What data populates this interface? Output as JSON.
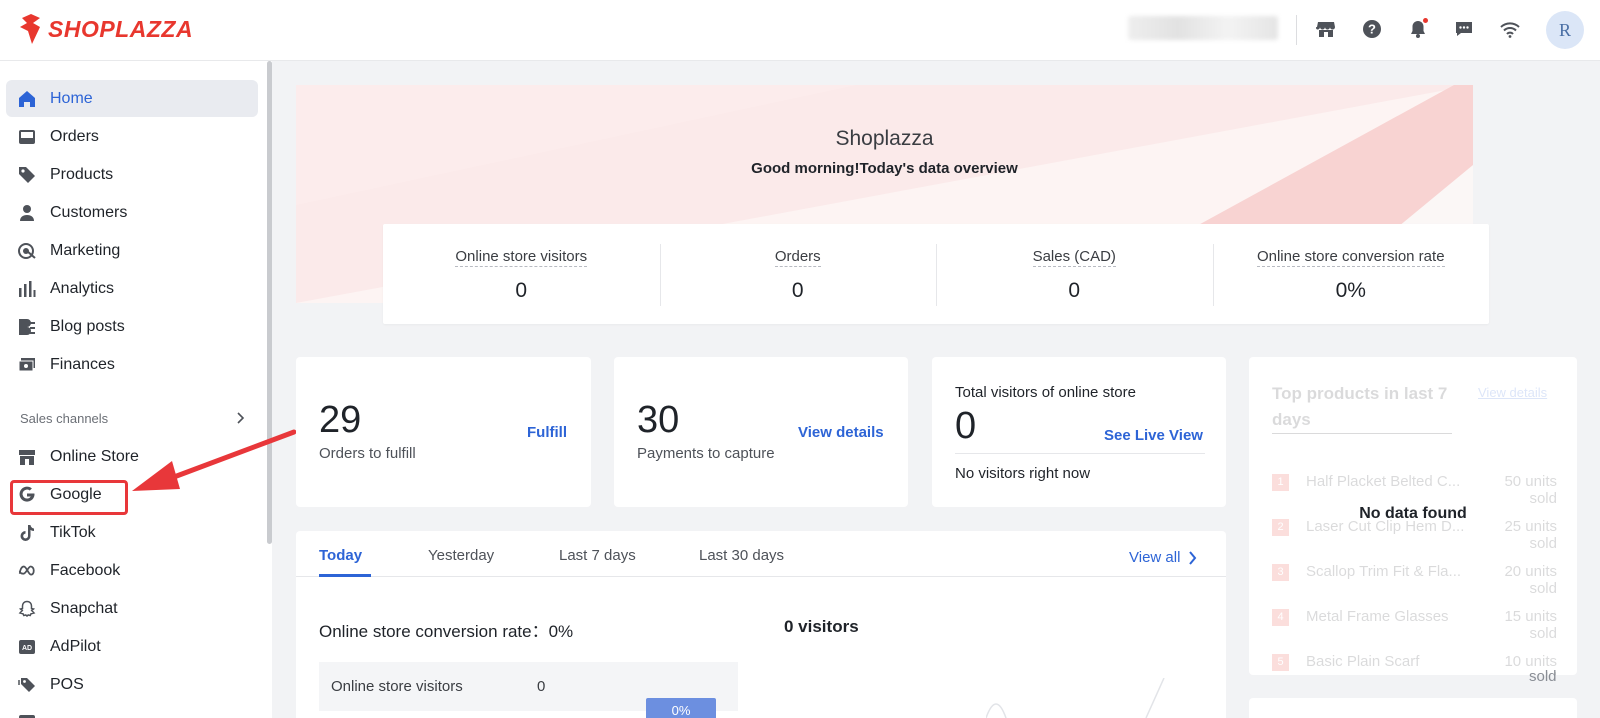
{
  "brand": {
    "name": "SHOPLAZZA",
    "accent": "#e8372e",
    "link": "#2d64d6"
  },
  "topbar": {
    "icons": [
      "store-icon",
      "help-icon",
      "bell-icon",
      "message-icon",
      "wifi-icon"
    ],
    "avatar": "R"
  },
  "sidebar": {
    "items": [
      {
        "label": "Home",
        "icon": "home-icon",
        "active": true
      },
      {
        "label": "Orders",
        "icon": "inbox-icon"
      },
      {
        "label": "Products",
        "icon": "tag-icon"
      },
      {
        "label": "Customers",
        "icon": "person-icon"
      },
      {
        "label": "Marketing",
        "icon": "target-icon"
      },
      {
        "label": "Analytics",
        "icon": "bar-chart-icon"
      },
      {
        "label": "Blog posts",
        "icon": "blog-icon"
      },
      {
        "label": "Finances",
        "icon": "wallet-icon"
      }
    ],
    "section_title": "Sales channels",
    "channels": [
      {
        "label": "Online Store",
        "icon": "store-icon"
      },
      {
        "label": "Google",
        "icon": "google-icon"
      },
      {
        "label": "TikTok",
        "icon": "tiktok-icon"
      },
      {
        "label": "Facebook",
        "icon": "meta-icon"
      },
      {
        "label": "Snapchat",
        "icon": "snapchat-icon"
      },
      {
        "label": "AdPilot",
        "icon": "ad-icon"
      },
      {
        "label": "POS",
        "icon": "tags-icon"
      }
    ]
  },
  "hero": {
    "title": "Shoplazza",
    "subtitle": "Good morning!Today's data overview",
    "stats": [
      {
        "label": "Online store visitors",
        "value": "0"
      },
      {
        "label": "Orders",
        "value": "0"
      },
      {
        "label": "Sales (CAD)",
        "value": "0"
      },
      {
        "label": "Online store conversion rate",
        "value": "0%"
      }
    ]
  },
  "cards": {
    "fulfill": {
      "number": "29",
      "label": "Orders to fulfill",
      "link": "Fulfill"
    },
    "payments": {
      "number": "30",
      "label": "Payments to capture",
      "link": "View details"
    },
    "visitors": {
      "title": "Total visitors of online store",
      "number": "0",
      "link": "See Live View",
      "status": "No visitors right now"
    }
  },
  "top_products": {
    "title": "Top products in last 7 days",
    "view": "View details",
    "empty": "No data found",
    "items": [
      {
        "rank": "1",
        "name": "Half Placket Belted C...",
        "units": "50 units sold"
      },
      {
        "rank": "2",
        "name": "Laser Cut Clip Hem D...",
        "units": "25 units sold"
      },
      {
        "rank": "3",
        "name": "Scallop Trim Fit & Fla...",
        "units": "20 units sold"
      },
      {
        "rank": "4",
        "name": "Metal Frame Glasses",
        "units": "15 units sold"
      },
      {
        "rank": "5",
        "name": "Basic Plain Scarf",
        "units": "10 units sold"
      }
    ],
    "overflow_text": "sold"
  },
  "panel": {
    "tabs": [
      "Today",
      "Yesterday",
      "Last 7 days",
      "Last 30 days"
    ],
    "view_all": "View all",
    "conversion_label": "Online store conversion rate：0%",
    "visitors_label": "0 visitors",
    "row_label": "Online store visitors",
    "row_value": "0",
    "pct_tag": "0%"
  }
}
